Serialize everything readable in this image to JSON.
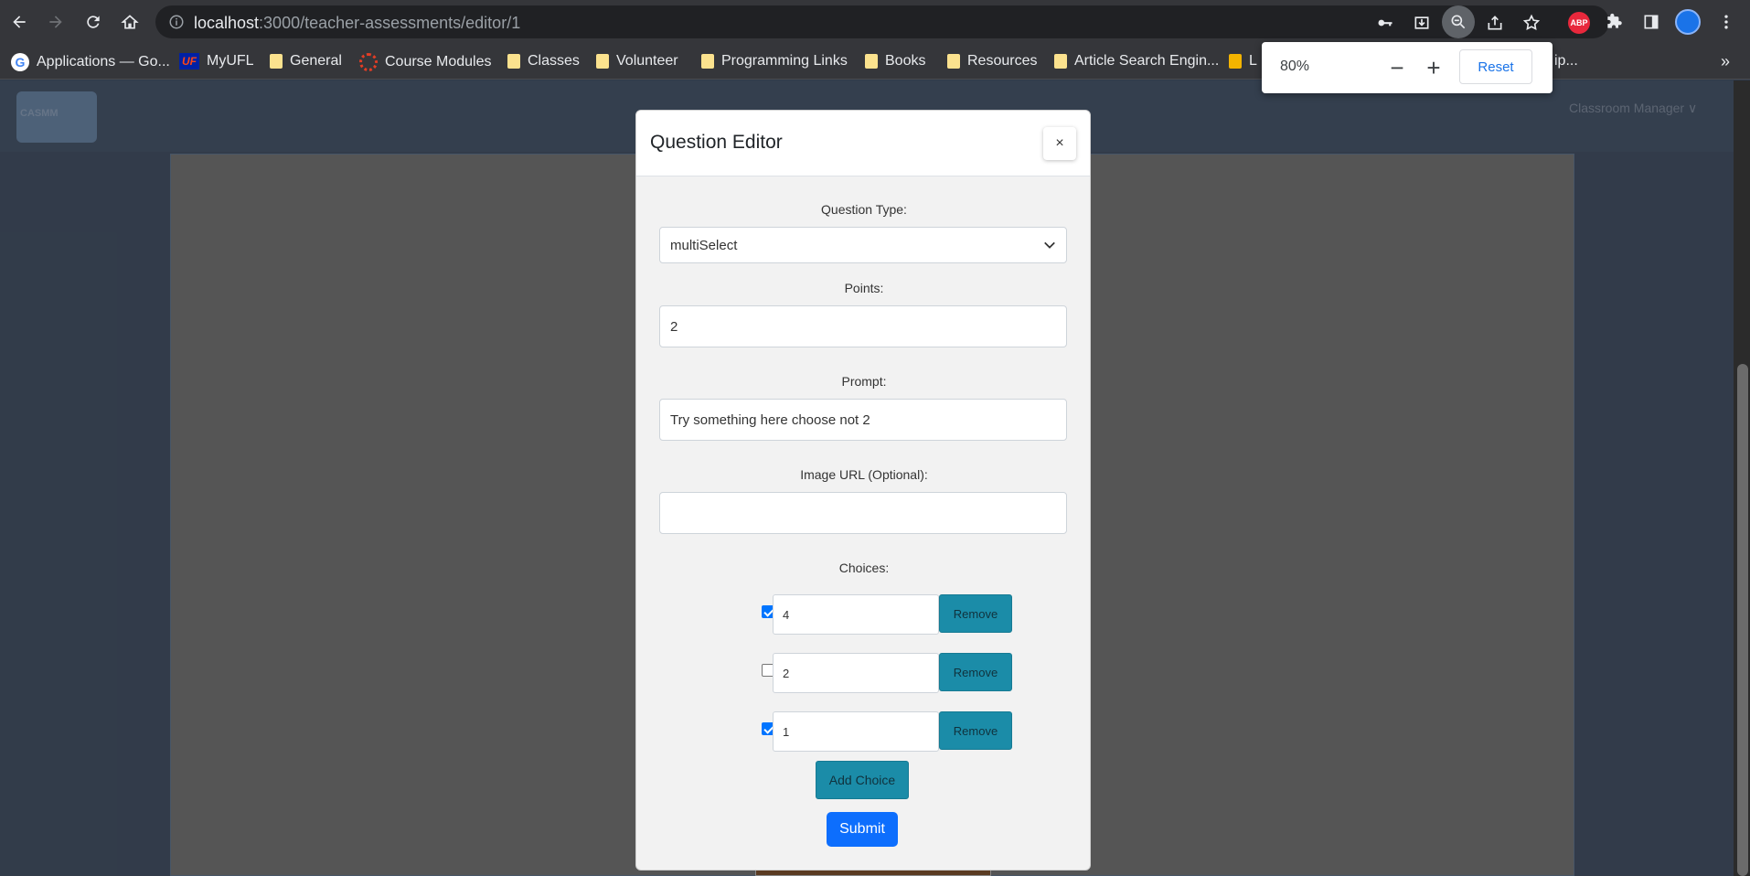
{
  "browser": {
    "url_host": "localhost",
    "url_path": ":3000/teacher-assessments/editor/1",
    "bookmarks": [
      {
        "label": "Applications — Go...",
        "icon": "google-icon"
      },
      {
        "label": "MyUFL",
        "icon": "uf-icon"
      },
      {
        "label": "General",
        "icon": "folder-icon"
      },
      {
        "label": "Course Modules",
        "icon": "canvas-icon"
      },
      {
        "label": "Classes",
        "icon": "folder-icon"
      },
      {
        "label": "Volunteer",
        "icon": "folder-icon"
      },
      {
        "label": "Programming Links",
        "icon": "folder-icon"
      },
      {
        "label": "Books",
        "icon": "folder-icon"
      },
      {
        "label": "Resources",
        "icon": "folder-icon"
      },
      {
        "label": "Article Search Engin...",
        "icon": "folder-icon"
      },
      {
        "label": "L",
        "icon": "link-icon"
      },
      {
        "label": "ip...",
        "icon": "folder-icon"
      }
    ],
    "bookmarks_more": "»",
    "abp_label": "ABP"
  },
  "zoom": {
    "value": "80%",
    "minus": "−",
    "plus": "+",
    "reset_label": "Reset"
  },
  "app": {
    "logo_text": "CASMM",
    "nav_label": "Classroom Manager ∨"
  },
  "modal": {
    "title": "Question Editor",
    "close": "×",
    "question_type_label": "Question Type:",
    "question_type_value": "multiSelect",
    "points_label": "Points:",
    "points_value": "2",
    "prompt_label": "Prompt:",
    "prompt_value": "Try something here choose not 2",
    "image_url_label": "Image URL (Optional):",
    "image_url_value": "",
    "choices_label": "Choices:",
    "choices": [
      {
        "value": "4",
        "checked": true,
        "remove_label": "Remove"
      },
      {
        "value": "2",
        "checked": false,
        "remove_label": "Remove"
      },
      {
        "value": "1",
        "checked": true,
        "remove_label": "Remove"
      }
    ],
    "add_choice_label": "Add Choice",
    "submit_label": "Submit"
  }
}
